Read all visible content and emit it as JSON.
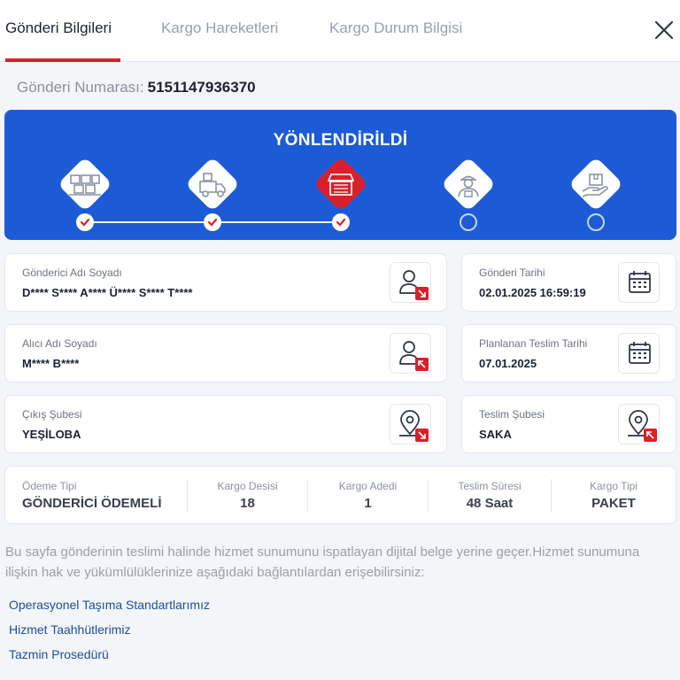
{
  "tabs": [
    {
      "label": "Gönderi Bilgileri",
      "active": true
    },
    {
      "label": "Kargo Hareketleri",
      "active": false
    },
    {
      "label": "Kargo Durum Bilgisi",
      "active": false
    }
  ],
  "close_icon": "close-icon",
  "shipment": {
    "label": "Gönderi Numarası:",
    "number": "5151147936370"
  },
  "status": {
    "title": "YÖNLENDİRİLDİ",
    "current_step": 3,
    "steps": [
      {
        "icon": "warehouse-boxes-icon",
        "state": "done"
      },
      {
        "icon": "delivery-truck-icon",
        "state": "done"
      },
      {
        "icon": "branch-store-icon",
        "state": "current"
      },
      {
        "icon": "courier-icon",
        "state": "pending"
      },
      {
        "icon": "package-hand-icon",
        "state": "pending"
      }
    ]
  },
  "details": {
    "sender": {
      "label": "Gönderici Adı Soyadı",
      "value": "D**** S**** A**** Ü**** S**** T****",
      "icon": "user-icon"
    },
    "send_date": {
      "label": "Gönderi Tarihi",
      "value": "02.01.2025 16:59:19",
      "icon": "calendar-icon"
    },
    "receiver": {
      "label": "Alıcı Adı Soyadı",
      "value": "M**** B****",
      "icon": "user-icon"
    },
    "planned_date": {
      "label": "Planlanan Teslim Tarihi",
      "value": "07.01.2025",
      "icon": "calendar-icon"
    },
    "origin_branch": {
      "label": "Çıkış Şubesi",
      "value": "YEŞİLOBA",
      "icon": "location-pin-icon"
    },
    "delivery_branch": {
      "label": "Teslim Şubesi",
      "value": "SAKA",
      "icon": "location-pin-icon"
    }
  },
  "summary": [
    {
      "label": "Ödeme Tipi",
      "value": "GÖNDERİCİ ÖDEMELİ"
    },
    {
      "label": "Kargo Desisi",
      "value": "18"
    },
    {
      "label": "Kargo Adedi",
      "value": "1"
    },
    {
      "label": "Teslim Süresi",
      "value": "48 Saat"
    },
    {
      "label": "Kargo Tipi",
      "value": "PAKET"
    }
  ],
  "notice": "Bu sayfa gönderinin teslimi halinde hizmet sunumunu ispatlayan dijital belge yerine geçer.Hizmet sunumuna ilişkin hak ve yükümlülüklerinize aşağıdaki bağlantılardan erişebilirsiniz:",
  "links": [
    "Operasyonel Taşıma Standartlarımız",
    "Hizmet Taahhütlerimiz",
    "Tazmin Prosedürü"
  ],
  "colors": {
    "accent": "#d9202a",
    "panel": "#1d5bd6",
    "link": "#1b4f96"
  }
}
